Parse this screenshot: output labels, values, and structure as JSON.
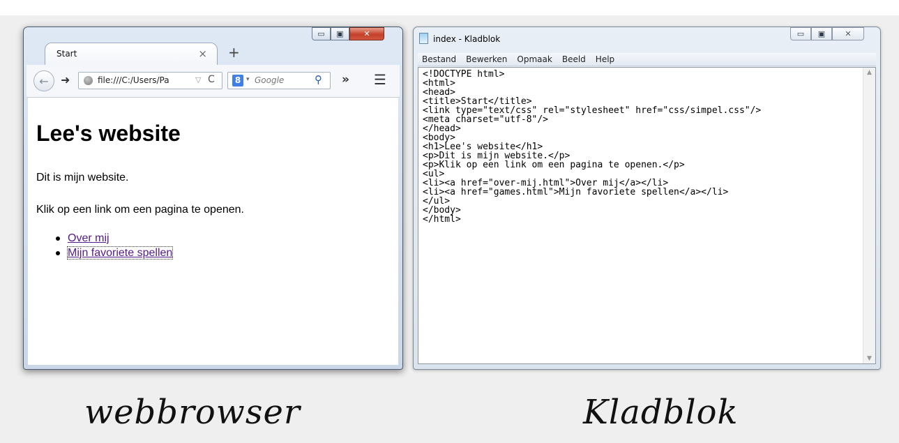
{
  "browser": {
    "tab_title": "Start",
    "tab_close": "×",
    "new_tab": "+",
    "back_icon": "←",
    "forward_icon": "➜",
    "url": "file:///C:/Users/Pa",
    "url_dropdown": "▽",
    "reload_icon": "C",
    "search_engine_icon": "8",
    "search_engine_arrow": "▾",
    "search_placeholder": "Google",
    "search_go_icon": "⚲",
    "overflow_icon": "»",
    "menu_icon": "☰",
    "caption": {
      "minimize": "▭",
      "maximize": "▣",
      "close": "✕"
    },
    "page": {
      "heading": "Lee's website",
      "paragraph1": "Dit is mijn website.",
      "paragraph2": "Klik op een link om een pagina te openen.",
      "links": [
        "Over mij",
        "Mijn favoriete spellen"
      ]
    }
  },
  "notepad": {
    "title": "index - Kladblok",
    "caption": {
      "minimize": "▭",
      "maximize": "▣",
      "close": "✕"
    },
    "menu": [
      "Bestand",
      "Bewerken",
      "Opmaak",
      "Beeld",
      "Help"
    ],
    "content": "<!DOCTYPE html>\n<html>\n<head>\n<title>Start</title>\n<link type=\"text/css\" rel=\"stylesheet\" href=\"css/simpel.css\"/>\n<meta charset=\"utf-8\"/>\n</head>\n<body>\n<h1>Lee's website</h1>\n<p>Dit is mijn website.</p>\n<p>Klik op een link om een pagina te openen.</p>\n<ul>\n<li><a href=\"over-mij.html\">Over mij</a></li>\n<li><a href=\"games.html\">Mijn favoriete spellen</a></li>\n</ul>\n</body>\n</html>",
    "scroll_up": "▲",
    "scroll_down": "▼"
  },
  "captions": {
    "left": "webbrowser",
    "right": "Kladblok"
  },
  "colors": {
    "link_visited": "#551a8b",
    "close_button": "#c4402a",
    "background": "#efefef"
  }
}
